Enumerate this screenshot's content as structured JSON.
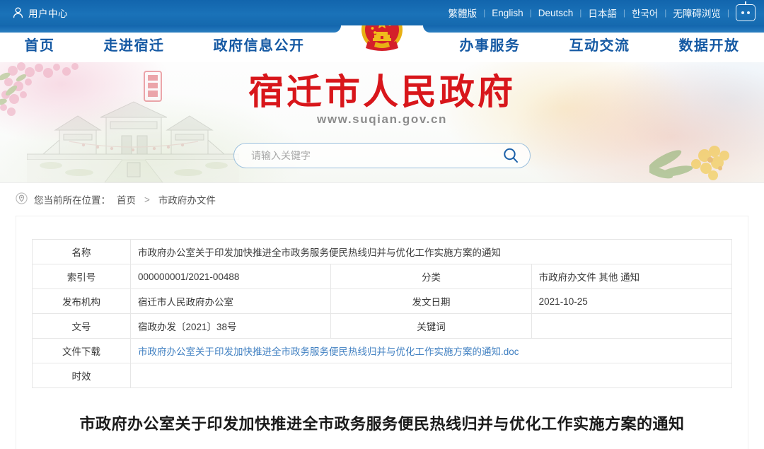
{
  "topbar": {
    "user_center": "用户中心",
    "user_icon": "user-icon",
    "languages": [
      {
        "label": "繁體版"
      },
      {
        "label": "English"
      },
      {
        "label": "Deutsch"
      },
      {
        "label": "日本語"
      },
      {
        "label": "한국어"
      },
      {
        "label": "无障碍浏览"
      }
    ],
    "separator": "|",
    "robot_icon": "robot-icon",
    "bg_color": "#1a72b8"
  },
  "nav": {
    "left_items": [
      {
        "label": "首页"
      },
      {
        "label": "走进宿迁"
      },
      {
        "label": "政府信息公开"
      }
    ],
    "right_items": [
      {
        "label": "办事服务"
      },
      {
        "label": "互动交流"
      },
      {
        "label": "数据开放"
      }
    ],
    "emblem_icon": "national-emblem-icon",
    "text_color": "#1559a3"
  },
  "banner": {
    "title_zh": "宿迁市人民政府",
    "title_color": "#d8161b",
    "url": "www.suqian.gov.cn",
    "gate_illustration": "historic-gate-illustration",
    "blossom_illustration": "cherry-blossom-illustration",
    "flower_illustration": "yellow-flower-illustration",
    "seal_illustration": "red-seal-illustration",
    "search": {
      "placeholder": "请输入关键字",
      "value": "",
      "icon": "search-icon"
    }
  },
  "breadcrumb": {
    "location_icon": "location-pin-icon",
    "prefix": "您当前所在位置：",
    "items": [
      {
        "label": "首页"
      },
      {
        "label": "市政府办文件"
      }
    ],
    "separator": ">"
  },
  "meta_table": {
    "rows": [
      {
        "label": "名称",
        "value": "市政府办公室关于印发加快推进全市政务服务便民热线归并与优化工作实施方案的通知",
        "full_width": true
      },
      {
        "label": "索引号",
        "value": "000000001/2021-00488",
        "label2": "分类",
        "value2": "市政府办文件  其他   通知"
      },
      {
        "label": "发布机构",
        "value": "宿迁市人民政府办公室",
        "label2": "发文日期",
        "value2": "2021-10-25"
      },
      {
        "label": "文号",
        "value": "宿政办发〔2021〕38号",
        "label2": "关键词",
        "value2": ""
      },
      {
        "label": "文件下载",
        "value": "市政府办公室关于印发加快推进全市政务服务便民热线归并与优化工作实施方案的通知.doc",
        "is_link": true,
        "full_width": true
      },
      {
        "label": "时效",
        "value": "",
        "full_width": true
      }
    ],
    "link_color": "#3f7fc1"
  },
  "document": {
    "title": "市政府办公室关于印发加快推进全市政务服务便民热线归并与优化工作实施方案的通知"
  }
}
